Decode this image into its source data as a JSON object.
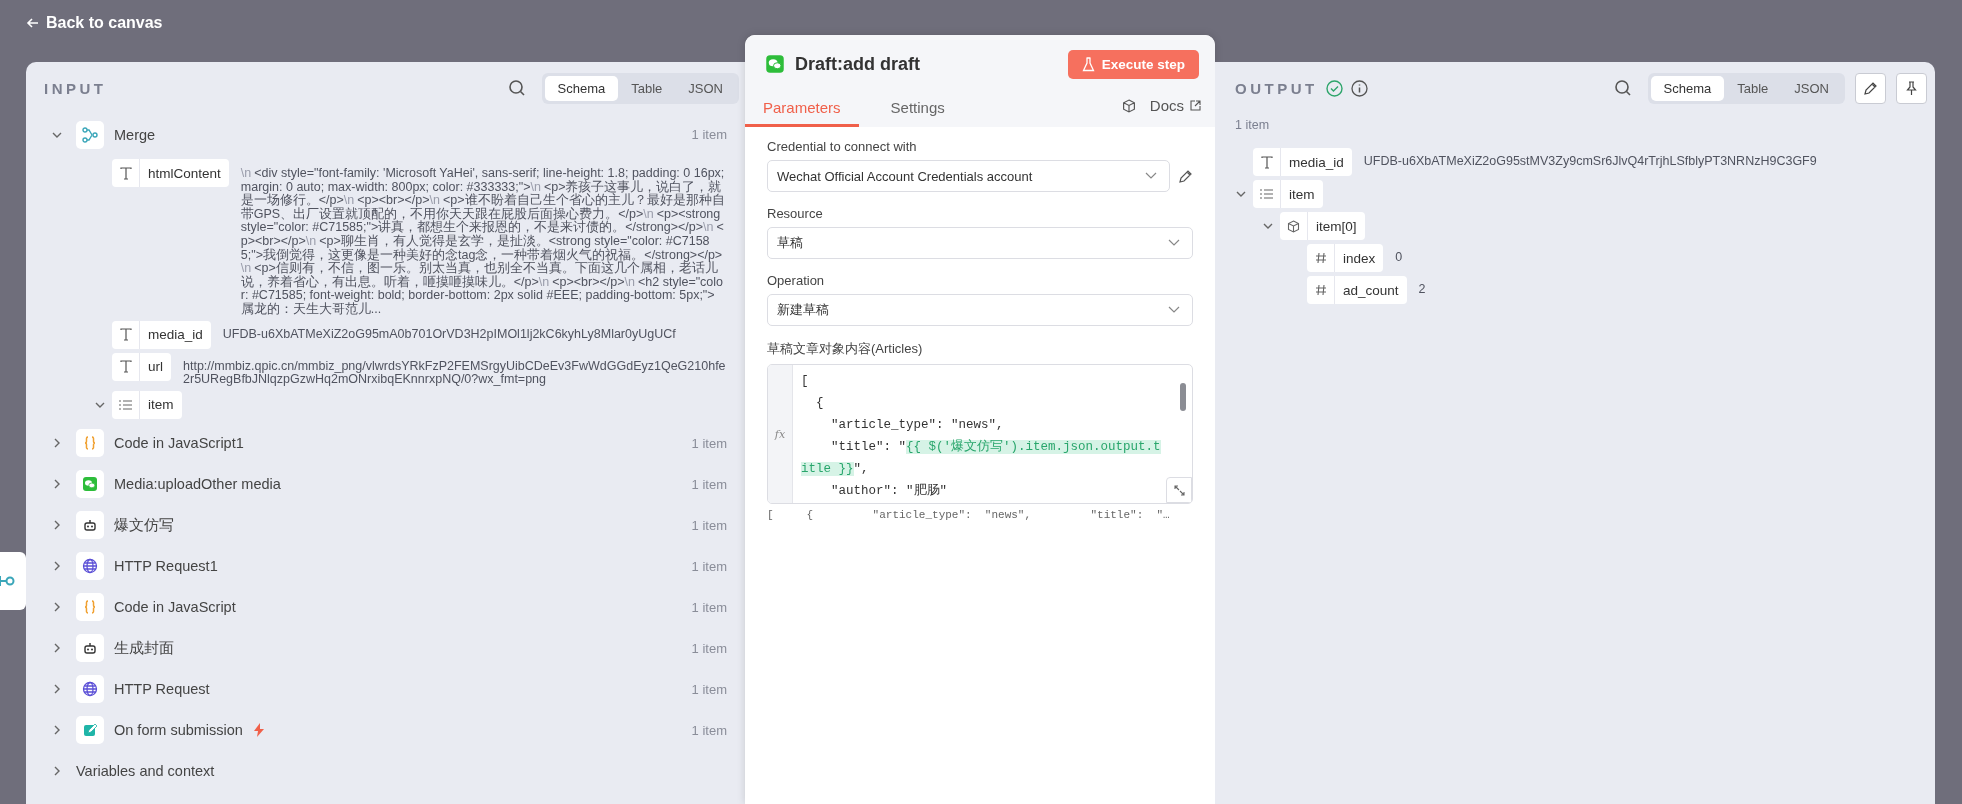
{
  "top_bar": {
    "back_link": "Back to canvas"
  },
  "input": {
    "title": "INPUT",
    "view_tabs": [
      {
        "label": "Schema",
        "selected": true
      },
      {
        "label": "Table",
        "selected": false
      },
      {
        "label": "JSON",
        "selected": false
      }
    ],
    "nodes": [
      {
        "name": "Merge",
        "kind": "merge",
        "count": "1 item",
        "expanded": true,
        "trigger": false,
        "fields": [
          {
            "name": "htmlContent",
            "kind": "string",
            "parts": [
              {
                "kind": "escape",
                "text": "\\n"
              },
              {
                "kind": "text",
                "text": "<div style=\"font-family: 'Microsoft YaHei', sans-serif; line-height: 1.8; padding: 0 16px; margin: 0 auto; max-width: 800px; color: #333333;\">"
              },
              {
                "kind": "escape",
                "text": "\\n"
              },
              {
                "kind": "text",
                "text": "<p>养孩子这事儿，说白了，就是一场修行。</p>"
              },
              {
                "kind": "escape",
                "text": "\\n"
              },
              {
                "kind": "text",
                "text": "<p><br></p>"
              },
              {
                "kind": "escape",
                "text": "\\n"
              },
              {
                "kind": "text",
                "text": "<p>谁不盼着自己生个省心的主儿？最好是那种自带GPS、出厂设置就顶配的，不用你天天跟在屁股后面操心费力。</p>"
              },
              {
                "kind": "escape",
                "text": "\\n"
              },
              {
                "kind": "text",
                "text": "<p><strong style=\"color: #C71585;\">讲真，都想生个来报恩的，不是来讨债的。</strong></p>"
              },
              {
                "kind": "escape",
                "text": "\\n"
              },
              {
                "kind": "text",
                "text": "<p><br></p>"
              },
              {
                "kind": "escape",
                "text": "\\n"
              },
              {
                "kind": "text",
                "text": "<p>聊生肖，有人觉得是玄学，是扯淡。<strong style=\"color: #C71585;\">我倒觉得，这更像是一种美好的念tag念，一种带着烟火气的祝福。</strong></p>"
              },
              {
                "kind": "escape",
                "text": "\\n"
              },
              {
                "kind": "text",
                "text": "<p>信则有，不信，图一乐。别太当真，也别全不当真。下面这几个属相，老话儿说，养着省心，有出息。听着，咂摸咂摸味儿。</p>"
              },
              {
                "kind": "escape",
                "text": "\\n"
              },
              {
                "kind": "text",
                "text": "<p><br></p>"
              },
              {
                "kind": "escape",
                "text": "\\n"
              },
              {
                "kind": "text",
                "text": "<h2 style=\"color: #C71585; font-weight: bold; border-bottom: 2px solid #EEE; padding-bottom: 5px;\">属龙的：天生大哥范儿..."
              }
            ]
          },
          {
            "name": "media_id",
            "kind": "string",
            "value": "UFDB-u6XbATMeXiZ2oG95mA0b701OrVD3H2pIMOl1lj2kC6kyhLy8Mlar0yUgUCf"
          },
          {
            "name": "url",
            "kind": "string",
            "value": "http://mmbiz.qpic.cn/mmbiz_png/vlwrdsYRkFzP2FEMSrgyUibCDeEv3FwWdGGdEyz1QeG210hfe2r5URegBfbJNlqzpGzwHq2mONrxibqEKnnrxpNQ/0?wx_fmt=png"
          },
          {
            "name": "item",
            "kind": "array",
            "expanded": true
          }
        ]
      },
      {
        "name": "Code in JavaScript1",
        "kind": "code",
        "count": "1 item",
        "expanded": false,
        "trigger": false
      },
      {
        "name": "Media:uploadOther media",
        "kind": "wechat",
        "count": "1 item",
        "expanded": false,
        "trigger": false
      },
      {
        "name": "爆文仿写",
        "kind": "robot",
        "count": "1 item",
        "expanded": false,
        "trigger": false
      },
      {
        "name": "HTTP Request1",
        "kind": "globe",
        "count": "1 item",
        "expanded": false,
        "trigger": false
      },
      {
        "name": "Code in JavaScript",
        "kind": "code",
        "count": "1 item",
        "expanded": false,
        "trigger": false
      },
      {
        "name": "生成封面",
        "kind": "robot",
        "count": "1 item",
        "expanded": false,
        "trigger": false
      },
      {
        "name": "HTTP Request",
        "kind": "globe",
        "count": "1 item",
        "expanded": false,
        "trigger": false
      },
      {
        "name": "On form submission",
        "kind": "form",
        "count": "1 item",
        "expanded": false,
        "trigger": true
      }
    ],
    "variables": {
      "label": "Variables and context",
      "expanded": false
    }
  },
  "node": {
    "title": "Draft:add draft",
    "execute_button": "Execute step",
    "tabs": [
      {
        "label": "Parameters",
        "selected": true
      },
      {
        "label": "Settings",
        "selected": false
      }
    ],
    "docs_link": "Docs",
    "params": [
      {
        "kind": "select",
        "label": "Credential to connect with",
        "value": "Wechat Official Account Credentials account",
        "editable": true
      },
      {
        "kind": "select",
        "label": "Resource",
        "value": "草稿",
        "editable": false
      },
      {
        "kind": "select",
        "label": "Operation",
        "value": "新建草稿",
        "editable": false
      },
      {
        "kind": "code",
        "label": "草稿文章对象内容(Articles)",
        "gutter": "fx",
        "lines": [
          [
            {
              "kind": "plain",
              "text": "["
            }
          ],
          [
            {
              "kind": "plain",
              "text": "  {"
            }
          ],
          [
            {
              "kind": "plain",
              "text": "    \"article_type\": \"news\","
            }
          ],
          [
            {
              "kind": "plain",
              "text": "    \"title\": \""
            },
            {
              "kind": "expression",
              "text": "{{ $('爆文仿写').item.json.output.title }}"
            },
            {
              "kind": "plain",
              "text": "\","
            }
          ],
          [
            {
              "kind": "plain",
              "text": "    \"author\": \"肥肠\""
            }
          ]
        ],
        "preview": "[     {         \"article_type\":  \"news\",         \"title\":  \"…"
      }
    ]
  },
  "output": {
    "title": "OUTPUT",
    "success": true,
    "view_tabs": [
      {
        "label": "Schema",
        "selected": true
      },
      {
        "label": "Table",
        "selected": false
      },
      {
        "label": "JSON",
        "selected": false
      }
    ],
    "count": "1 item",
    "fields": [
      {
        "name": "media_id",
        "kind": "string",
        "value": "UFDB-u6XbATMeXiZ2oG95stMV3Zy9cmSr6JlvQ4rTrjhLSfblyPT3NRNzH9C3GF9"
      },
      {
        "name": "item",
        "kind": "array",
        "expanded": true,
        "children": [
          {
            "name": "item[0]",
            "kind": "object",
            "expanded": true,
            "children": [
              {
                "name": "index",
                "kind": "number",
                "value": "0"
              },
              {
                "name": "ad_count",
                "kind": "number",
                "value": "2"
              }
            ]
          }
        ]
      }
    ]
  }
}
